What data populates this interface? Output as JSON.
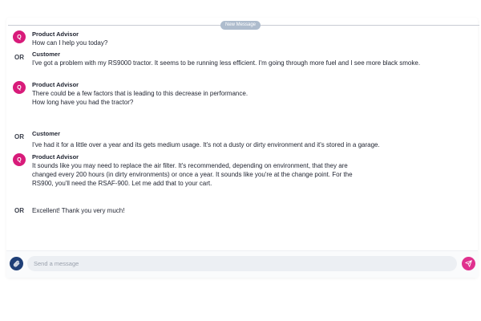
{
  "divider": {
    "label": "New Message"
  },
  "messages": [
    {
      "role": "bot",
      "initials": "Q",
      "sender": "Product Advisor",
      "lines": [
        "How can I help you today?"
      ]
    },
    {
      "role": "user",
      "initials": "OR",
      "sender": "Customer",
      "lines": [
        "I've got a problem with my RS9000 tractor. It seems to be running less efficient. I'm going through more fuel and I see more black smoke."
      ]
    },
    {
      "role": "bot",
      "initials": "Q",
      "sender": "Product Advisor",
      "lines": [
        "There could be a few factors that is leading to this decrease in performance.",
        "How long have you had the tractor?"
      ]
    },
    {
      "role": "user",
      "initials": "OR",
      "sender": "Customer",
      "lines": [
        "I've had it for a little over a year and its gets medium usage. It's not a dusty or dirty environment and it's stored in a garage."
      ]
    },
    {
      "role": "bot",
      "initials": "Q",
      "sender": "Product Advisor",
      "lines": [
        "It sounds like you may need to replace the air filter. It's recommended, depending on environment, that they are",
        "changed every 200 hours (in dirty environments) or once a year. It sounds like you're at the change point. For the",
        "RS900, you'll need the RSAF-900. Let me add that to your cart."
      ]
    },
    {
      "role": "user",
      "initials": "OR",
      "sender": "",
      "lines": [
        "Excellent! Thank you very much!"
      ]
    }
  ],
  "composer": {
    "placeholder": "Send a message"
  },
  "icons": {
    "attach": "paperclip-icon",
    "send": "send-icon"
  },
  "colors": {
    "accent": "#d81b7a",
    "attach_button": "#1f3f77",
    "send_button": "#e0318e",
    "divider_pill": "#aebccd"
  }
}
